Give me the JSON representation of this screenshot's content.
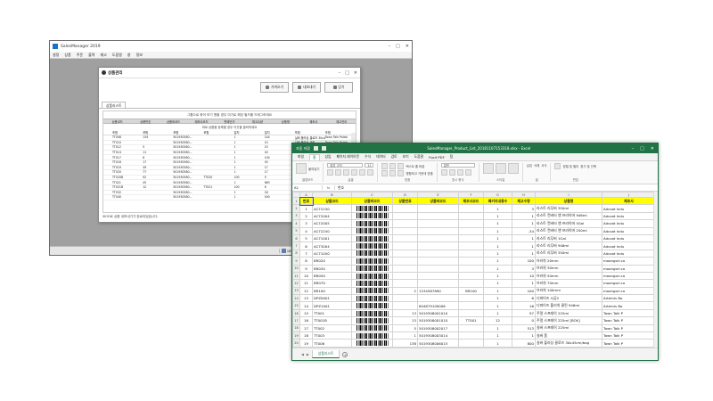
{
  "app": {
    "title": "SalesManager 2019",
    "menu": [
      "설정",
      "상품",
      "주문",
      "출력",
      "재고",
      "도움말",
      "창",
      "정보"
    ],
    "status": [
      {
        "icon": "stock-icon",
        "value": "169,300"
      },
      {
        "icon": "money-icon",
        "value": "5,349,200"
      },
      {
        "icon": "money-icon",
        "value": "52,591,600"
      },
      {
        "icon": "database-icon",
        "value": "localhost"
      },
      {
        "icon": "user-icon",
        "value": "관리자"
      }
    ]
  },
  "dialog": {
    "title": "상품관리",
    "buttons": [
      "가져오기",
      "내보내기",
      "닫기"
    ],
    "tab": "상품리스트",
    "hint_top": "그룹으로 묶어 보기 원할 경우 여기로 해당 필드를 드래그하세요",
    "columns": [
      "상품코드",
      "상품번호",
      "상품바코드",
      "제조사코드",
      "판매단가",
      "재고수량",
      "상품명",
      "제조사",
      "재고관리"
    ],
    "hint_mid": "바로 상품을 등록할 경우 이곳을 클릭하세요",
    "filter": [
      "포함",
      "포함",
      "포함",
      "포함",
      "일치",
      "일치",
      "포함",
      "포함"
    ],
    "rows": [
      [
        "TT008",
        "134",
        "501930580...",
        "",
        "1",
        "144",
        "실버 플러싱 클로즈 30x45cm/bag",
        "Town Talk Polish"
      ],
      [
        "TT010",
        "",
        "501930580...",
        "",
        "1",
        "10",
        "실버 플러싱 크림",
        "Town Talk Polish"
      ],
      [
        "TT012",
        "5",
        "501930580...",
        "",
        "1",
        "15",
        "실버 플러싱 크림",
        "Town Talk Polish"
      ],
      [
        "TT014",
        "11",
        "501930580...",
        "",
        "1",
        "40",
        "딥 메이 크림",
        "Town Talk Polish"
      ],
      [
        "TT017",
        "8",
        "501930580...",
        "",
        "1",
        "100",
        "실버 플러싱 크림",
        "Town Talk Polish"
      ],
      [
        "TT018",
        "17",
        "501930580...",
        "",
        "1",
        "45",
        "골드 펄 크림",
        "Town Talk Polish"
      ],
      [
        "TT019",
        "49",
        "501930580...",
        "",
        "1",
        "17",
        "딥 메이 크림",
        "Town Talk Polish"
      ],
      [
        "TT020",
        "77",
        "501930580...",
        "",
        "1",
        "17",
        "실버 플러싱 클로즈 12.5x17.5cm",
        "Town Talk Polish"
      ],
      [
        "TT020B",
        "92",
        "501930580...",
        "TT020",
        "100",
        "9",
        "실버 플러싱 클로즈 12.5x17.5cm [BOX]",
        "Town Talk Polish"
      ],
      [
        "TT021",
        "45",
        "501930580...",
        "",
        "1",
        "863",
        "골드 플러싱 클로즈 12.5x17.5cm",
        "Town Talk Polish"
      ],
      [
        "TT021B",
        "12",
        "501930580...",
        "TT021",
        "100",
        "6",
        "골드 플러싱 클로즈 [BOX]",
        "Town Talk Polish"
      ],
      [
        "TT032",
        "",
        "501930580...",
        "",
        "1",
        "18",
        "주얼 스프레이 50ml",
        "Town Talk Polish"
      ],
      [
        "TT040",
        "",
        "501930580...",
        "",
        "1",
        "400",
        "실버 스토리지 스트립스",
        "Town Talk Polish"
      ]
    ],
    "footer": "SKIO로 상품 내보내기가 완료되었습니다."
  },
  "excel": {
    "title": "SalesManager_Product_List_20181107153318.xlsx  -  Excel",
    "autosave": "자동 저장",
    "ribbon_tabs": [
      "파일",
      "홈",
      "삽입",
      "페이지 레이아웃",
      "수식",
      "데이터",
      "검토",
      "보기",
      "도움말",
      "Foxit PDF",
      "팀"
    ],
    "ribbon": {
      "paste": "붙여넣기",
      "clipboard": "클립보드",
      "font_name": "맑은 고딕",
      "font_size": "11",
      "font_group": "글꼴",
      "wrap": "텍스트 줄 바꿈",
      "merge": "병합하고 가운데 맞춤",
      "align_group": "맞춤",
      "number_format": "일반",
      "number_group": "표시 형식",
      "styles_group": "스타일",
      "cells_group": "셀",
      "edit_group": "편집",
      "insert": "삽입",
      "delete": "삭제",
      "format": "서식",
      "sort_filter": "정렬 및 필터",
      "find": "찾기 및 선택"
    },
    "name_box": "A1",
    "fx": "fx",
    "formula": "번호",
    "col_letters": [
      "A",
      "B",
      "C",
      "D",
      "E",
      "F",
      "G",
      "H",
      "I",
      "J"
    ],
    "headers": [
      "번호",
      "상품코드",
      "상품바코드",
      "상품번호",
      "상품바코드",
      "제조사코드",
      "패키지내용수",
      "재고수량",
      "상품명",
      "제조사"
    ],
    "rows": [
      [
        "1",
        "AC72150",
        true,
        "",
        "",
        "",
        "1",
        "3",
        "라스트 리무버 350ml",
        "Adcoat Indu"
      ],
      [
        "2",
        "AC72004",
        true,
        "",
        "",
        "",
        "1",
        "1",
        "라스트 컨버터 앤 프라이머 946ml",
        "Adcoat Indu"
      ],
      [
        "3",
        "AC72005",
        true,
        "",
        "",
        "",
        "1",
        "1",
        "라스트 컨버터 앤 프라이머 5Gal",
        "Adcoat Indu"
      ],
      [
        "4",
        "AC72250",
        true,
        "",
        "",
        "",
        "1",
        "-34",
        "라스트 컨버터 앤 프라이머 250ml",
        "Adcoat Indu"
      ],
      [
        "5",
        "AC71001",
        true,
        "",
        "",
        "",
        "1",
        "1",
        "라스트 리무버 1Gal",
        "Adcoat Indu"
      ],
      [
        "6",
        "AC73004",
        true,
        "",
        "",
        "",
        "1",
        "1",
        "라스트 리무버 946ml",
        "Adcoat Indu"
      ],
      [
        "7",
        "AC71050",
        true,
        "",
        "",
        "",
        "1",
        "1",
        "라스트 리무버 350ml",
        "Adcoat Indu"
      ],
      [
        "8",
        "BR020",
        true,
        "",
        "",
        "",
        "1",
        "100",
        "브러쉬 20mm",
        "moongori.co"
      ],
      [
        "9",
        "BR030",
        true,
        "",
        "",
        "",
        "1",
        "3",
        "브러쉬 30mm",
        "moongori.co"
      ],
      [
        "10",
        "BR050",
        true,
        "",
        "",
        "",
        "1",
        "10",
        "브러쉬 50mm",
        "moongori.co"
      ],
      [
        "11",
        "BR070",
        true,
        "",
        "",
        "",
        "1",
        "1",
        "브러쉬 70mm",
        "moongori.co"
      ],
      [
        "12",
        "BR100",
        true,
        "2",
        "1234567890",
        "BR100",
        "1",
        "100",
        "브러쉬 100mm",
        "moongori.co"
      ],
      [
        "13",
        "DPZ0001",
        true,
        "",
        "",
        "",
        "1",
        "6",
        "디파이즈 시공2",
        "Artemis Bo"
      ],
      [
        "14",
        "DPZ1001",
        true,
        "",
        "804879109006",
        "",
        "1",
        "16",
        "디파이즈 폴리쉬 클린 946ml",
        "Artemis Bo"
      ],
      [
        "15",
        "TT001",
        true,
        "13",
        "5019308001010",
        "",
        "1",
        "97",
        "주얼 스프레이 225ml",
        "Town Talk P"
      ],
      [
        "16",
        "TT001B",
        true,
        "13",
        "5019308001010",
        "TT001",
        "12",
        "0",
        "주얼 스프레이 225ml [BOX]",
        "Town Talk P"
      ],
      [
        "17",
        "TT002",
        true,
        "5",
        "5019308002017",
        "",
        "1",
        "513",
        "실버 스프레이 225ml",
        "Town Talk P"
      ],
      [
        "18",
        "TT003",
        true,
        "1",
        "5019308003014",
        "",
        "1",
        "1",
        "실버 폼",
        "Town Talk P"
      ],
      [
        "19",
        "TT006",
        true,
        "138",
        "5019308006015",
        "",
        "1",
        "800",
        "실버 플러싱 클로즈 30x45cm/bag",
        "Town Talk P"
      ]
    ],
    "sheet_tab": "상품리스트",
    "add_sheet": "+"
  }
}
